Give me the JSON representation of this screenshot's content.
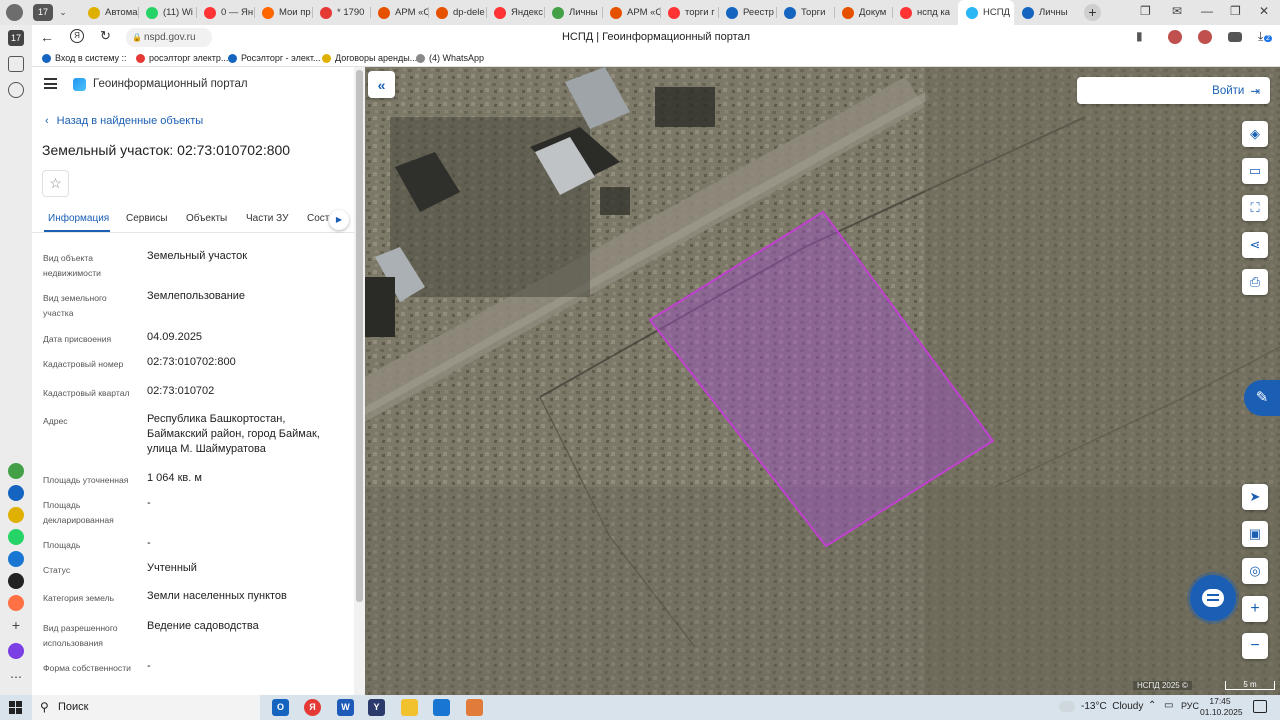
{
  "colors": {
    "accent": "#1a5fb4",
    "parcel_stroke": "#c040d0",
    "parcel_fill": "#a050c8"
  },
  "browser": {
    "tab_counter": "17",
    "tabs": [
      {
        "label": "Автома",
        "color": "#e0b000"
      },
      {
        "label": "(11) Wi",
        "color": "#25d366"
      },
      {
        "label": "0 — Ян",
        "color": "#ff3333"
      },
      {
        "label": "Мои пр",
        "color": "#ff6600"
      },
      {
        "label": "* 1790",
        "color": "#e53935"
      },
      {
        "label": "АРМ «С",
        "color": "#e65100"
      },
      {
        "label": "dp-dele",
        "color": "#e65100"
      },
      {
        "label": "Яндекс",
        "color": "#ff3333"
      },
      {
        "label": "Личны",
        "color": "#43a047"
      },
      {
        "label": "АРМ «С",
        "color": "#e65100"
      },
      {
        "label": "торги г",
        "color": "#ff3333"
      },
      {
        "label": "Реестр",
        "color": "#1565c0"
      },
      {
        "label": "Торги",
        "color": "#1565c0"
      },
      {
        "label": "Докум",
        "color": "#e65100"
      },
      {
        "label": "нспд ка",
        "color": "#ff3333"
      },
      {
        "label": "НСПД",
        "color": "#29b6f6",
        "active": true
      },
      {
        "label": "Личны",
        "color": "#1565c0"
      }
    ],
    "address": "nspd.gov.ru",
    "page_title": "НСПД | Геоинформационный портал",
    "download_badge": "2",
    "bookmarks": [
      {
        "label": "Вход в систему :: ",
        "color": "#1565c0"
      },
      {
        "label": "росэлторг электр...",
        "color": "#e53935"
      },
      {
        "label": "Росэлторг - элект...",
        "color": "#1565c0"
      },
      {
        "label": "Договоры аренды...",
        "color": "#e0b000"
      },
      {
        "label": "(4) WhatsApp",
        "color": "#888888"
      }
    ]
  },
  "portal": {
    "title": "Геоинформационный портал",
    "back_link": "Назад в найденные объекты",
    "object_title": "Земельный участок: 02:73:010702:800",
    "tabs": [
      "Информация",
      "Сервисы",
      "Объекты",
      "Части ЗУ",
      "Соста"
    ],
    "active_tab": 0,
    "fields": [
      {
        "label": "Вид объекта недвижимости",
        "value": "Земельный участок"
      },
      {
        "label": "Вид земельного участка",
        "value": "Землепользование"
      },
      {
        "label": "Дата присвоения",
        "value": "04.09.2025"
      },
      {
        "label": "Кадастровый номер",
        "value": "02:73:010702:800"
      },
      {
        "label": "Кадастровый квартал",
        "value": "02:73:010702"
      },
      {
        "label": "Адрес",
        "value": "Республика Башкортостан, Баймакский район, город Баймак, улица М. Шаймуратова"
      },
      {
        "label": "Площадь уточненная",
        "value": "1 064 кв. м"
      },
      {
        "label": "Площадь декларированная",
        "value": "-"
      },
      {
        "label": "Площадь",
        "value": "-"
      },
      {
        "label": "Статус",
        "value": "Учтенный"
      },
      {
        "label": "Категория земель",
        "value": "Земли населенных пунктов"
      },
      {
        "label": "Вид разрешенного использования",
        "value": "Ведение садоводства"
      },
      {
        "label": "Форма собственности",
        "value": "-"
      }
    ]
  },
  "map": {
    "login_label": "Войти",
    "attribution": "НСПД 2025 ©",
    "scale_label": "5 m"
  },
  "taskbar": {
    "search_placeholder": "Поиск",
    "weather": "-13°C  Cloudy",
    "language": "РУС",
    "time": "17:45",
    "date": "01.10.2025"
  }
}
